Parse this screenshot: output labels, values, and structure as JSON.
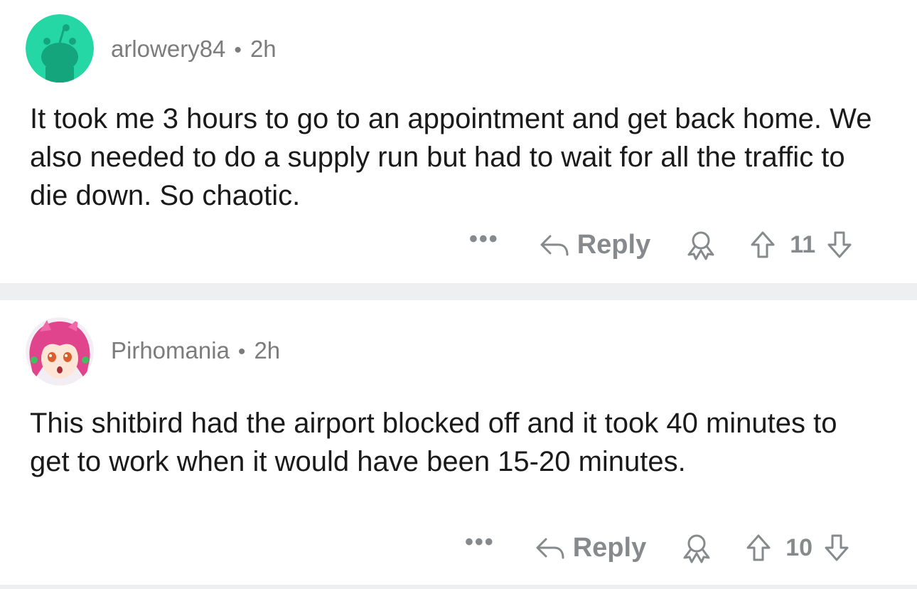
{
  "comments": [
    {
      "username": "arlowery84",
      "separator": "•",
      "time": "2h",
      "text": "It took me 3 hours to go to an appointment and get back home. We also needed to do a supply run but had to wait for all the traffic to die down. So chaotic.",
      "actions": {
        "more": "•••",
        "reply_label": "Reply",
        "score": "11"
      },
      "avatar_color": "#24d7a4"
    },
    {
      "username": "Pirhomania",
      "separator": "•",
      "time": "2h",
      "text": "This shitbird had the airport blocked off and it took 40 minutes to get to work when it would have been 15-20 minutes.",
      "actions": {
        "more": "•••",
        "reply_label": "Reply",
        "score": "10"
      },
      "avatar_color": "#e6468f"
    }
  ],
  "colors": {
    "meta": "#7c7c7c",
    "divider": "#edeff1",
    "icon": "#878a8c"
  }
}
